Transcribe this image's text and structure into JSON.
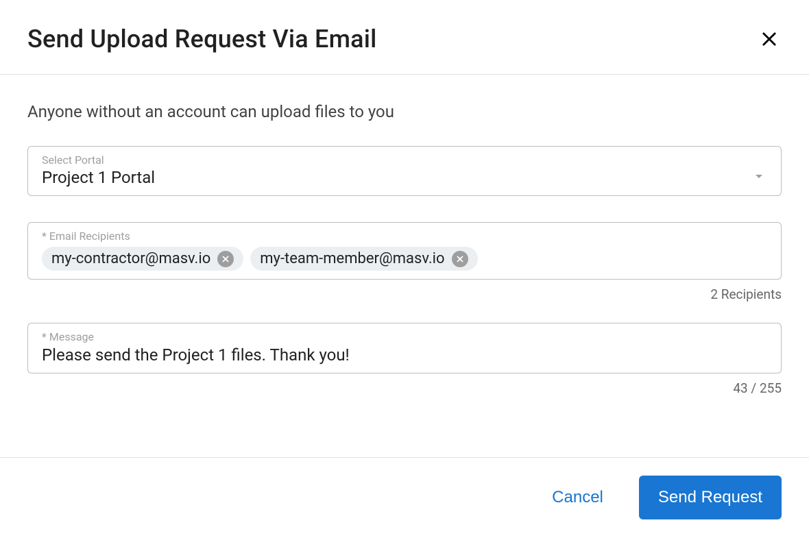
{
  "header": {
    "title": "Send Upload Request Via Email"
  },
  "body": {
    "subtitle": "Anyone without an account can upload files to you",
    "portal": {
      "label": "Select Portal",
      "value": "Project 1 Portal"
    },
    "recipients": {
      "label": "* Email Recipients",
      "chips": [
        "my-contractor@masv.io",
        "my-team-member@masv.io"
      ],
      "count_text": "2 Recipients"
    },
    "message": {
      "label": "* Message",
      "value": "Please send the Project 1 files. Thank you!",
      "counter": "43 / 255"
    }
  },
  "footer": {
    "cancel": "Cancel",
    "send": "Send Request"
  }
}
